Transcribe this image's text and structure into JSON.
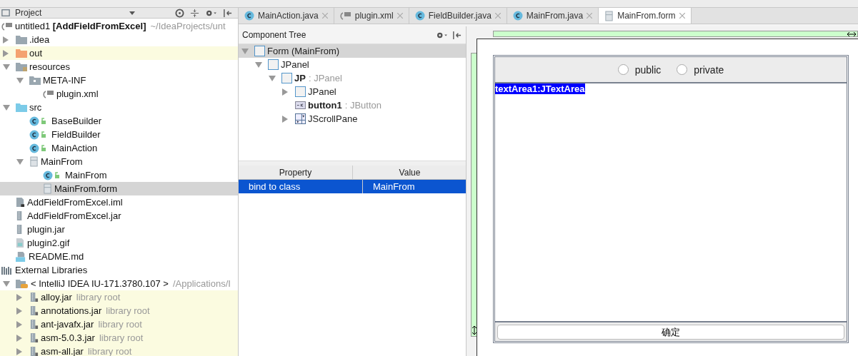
{
  "project_panel": {
    "title": "Project",
    "tree": [
      {
        "label": "untitled1 **[AddFieldFromExcel]**",
        "suffix": "~/IdeaProjects/unt",
        "kind": "module",
        "selected": false,
        "highlighted": false,
        "children": [
          {
            "label": ".idea",
            "kind": "folder",
            "expanded": false,
            "selected": false,
            "highlighted": false
          },
          {
            "label": "out",
            "kind": "excluded-folder",
            "expanded": false,
            "selected": false,
            "highlighted": true
          },
          {
            "label": "resources",
            "kind": "resource-folder",
            "expanded": true,
            "selected": false,
            "highlighted": false,
            "children": [
              {
                "label": "META-INF",
                "kind": "package",
                "expanded": true,
                "selected": false,
                "highlighted": false,
                "children": [
                  {
                    "label": "plugin.xml",
                    "kind": "xml",
                    "selected": false,
                    "highlighted": false
                  }
                ]
              }
            ]
          },
          {
            "label": "src",
            "kind": "source-folder",
            "expanded": true,
            "selected": false,
            "highlighted": false,
            "children": [
              {
                "label": "BaseBuilder",
                "kind": "class",
                "selected": false,
                "highlighted": false
              },
              {
                "label": "FieldBuilder",
                "kind": "class",
                "selected": false,
                "highlighted": false
              },
              {
                "label": "MainAction",
                "kind": "class",
                "selected": false,
                "highlighted": false
              },
              {
                "label": "MainFrom",
                "kind": "form",
                "expanded": true,
                "selected": false,
                "highlighted": false,
                "children": [
                  {
                    "label": "MainFrom",
                    "kind": "class",
                    "selected": false,
                    "highlighted": false
                  },
                  {
                    "label": "MainFrom.form",
                    "kind": "form",
                    "selected": true,
                    "highlighted": false
                  }
                ]
              }
            ]
          },
          {
            "label": "AddFieldFromExcel.iml",
            "kind": "iml",
            "selected": false,
            "highlighted": false
          },
          {
            "label": "AddFieldFromExcel.jar",
            "kind": "jar",
            "selected": false,
            "highlighted": false
          },
          {
            "label": "plugin.jar",
            "kind": "jar",
            "selected": false,
            "highlighted": false
          },
          {
            "label": "plugin2.gif",
            "kind": "image",
            "selected": false,
            "highlighted": false
          },
          {
            "label": "README.md",
            "kind": "markdown",
            "selected": false,
            "highlighted": false
          }
        ]
      },
      {
        "label": "External Libraries",
        "kind": "libraries",
        "selected": false,
        "highlighted": false,
        "children": [
          {
            "label": "< IntelliJ IDEA IU-171.3780.107 >",
            "suffix": "/Applications/I",
            "kind": "sdk",
            "expanded": true,
            "selected": false,
            "highlighted": false,
            "children": [
              {
                "label": "alloy.jar",
                "suffix": "library root",
                "kind": "library-jar",
                "expanded": false,
                "selected": false,
                "highlighted": true
              },
              {
                "label": "annotations.jar",
                "suffix": "library root",
                "kind": "library-jar",
                "expanded": false,
                "selected": false,
                "highlighted": true
              },
              {
                "label": "ant-javafx.jar",
                "suffix": "library root",
                "kind": "library-jar",
                "expanded": false,
                "selected": false,
                "highlighted": true
              },
              {
                "label": "asm-5.0.3.jar",
                "suffix": "library root",
                "kind": "library-jar",
                "expanded": false,
                "selected": false,
                "highlighted": true
              },
              {
                "label": "asm-all.jar",
                "suffix": "library root",
                "kind": "library-jar",
                "expanded": false,
                "selected": false,
                "highlighted": true
              }
            ]
          }
        ]
      }
    ]
  },
  "tabs": [
    {
      "label": "MainAction.java",
      "kind": "class",
      "selected": false
    },
    {
      "label": "plugin.xml",
      "kind": "xml",
      "selected": false
    },
    {
      "label": "FieldBuilder.java",
      "kind": "class",
      "selected": false
    },
    {
      "label": "MainFrom.java",
      "kind": "class",
      "selected": false
    },
    {
      "label": "MainFrom.form",
      "kind": "form",
      "selected": true
    }
  ],
  "component_tree": {
    "title": "Component Tree",
    "items": [
      {
        "name": "Form (MainFrom)",
        "kind": "panel",
        "expanded": true,
        "selected": true,
        "children": [
          {
            "name": "JPanel",
            "kind": "panel",
            "expanded": true,
            "selected": false,
            "children": [
              {
                "name": "JP",
                "type": ": JPanel",
                "kind": "panel",
                "expanded": true,
                "selected": false,
                "children": [
                  {
                    "name": "JPanel",
                    "kind": "panel",
                    "expanded": false,
                    "selected": false
                  },
                  {
                    "name": "button1",
                    "type": ": JButton",
                    "kind": "button",
                    "selected": false
                  },
                  {
                    "name": "JScrollPane",
                    "kind": "scrollpane",
                    "expanded": false,
                    "selected": false
                  }
                ]
              }
            ]
          }
        ]
      }
    ]
  },
  "properties": {
    "columns": [
      "Property",
      "Value"
    ],
    "rows": [
      {
        "property": "bind to class",
        "value": "MainFrom",
        "selected": true
      }
    ]
  },
  "designer": {
    "radios": [
      {
        "label": "public",
        "checked": false
      },
      {
        "label": "private",
        "checked": false
      }
    ],
    "text_area": "textArea1:JTextArea",
    "button": "确定"
  }
}
